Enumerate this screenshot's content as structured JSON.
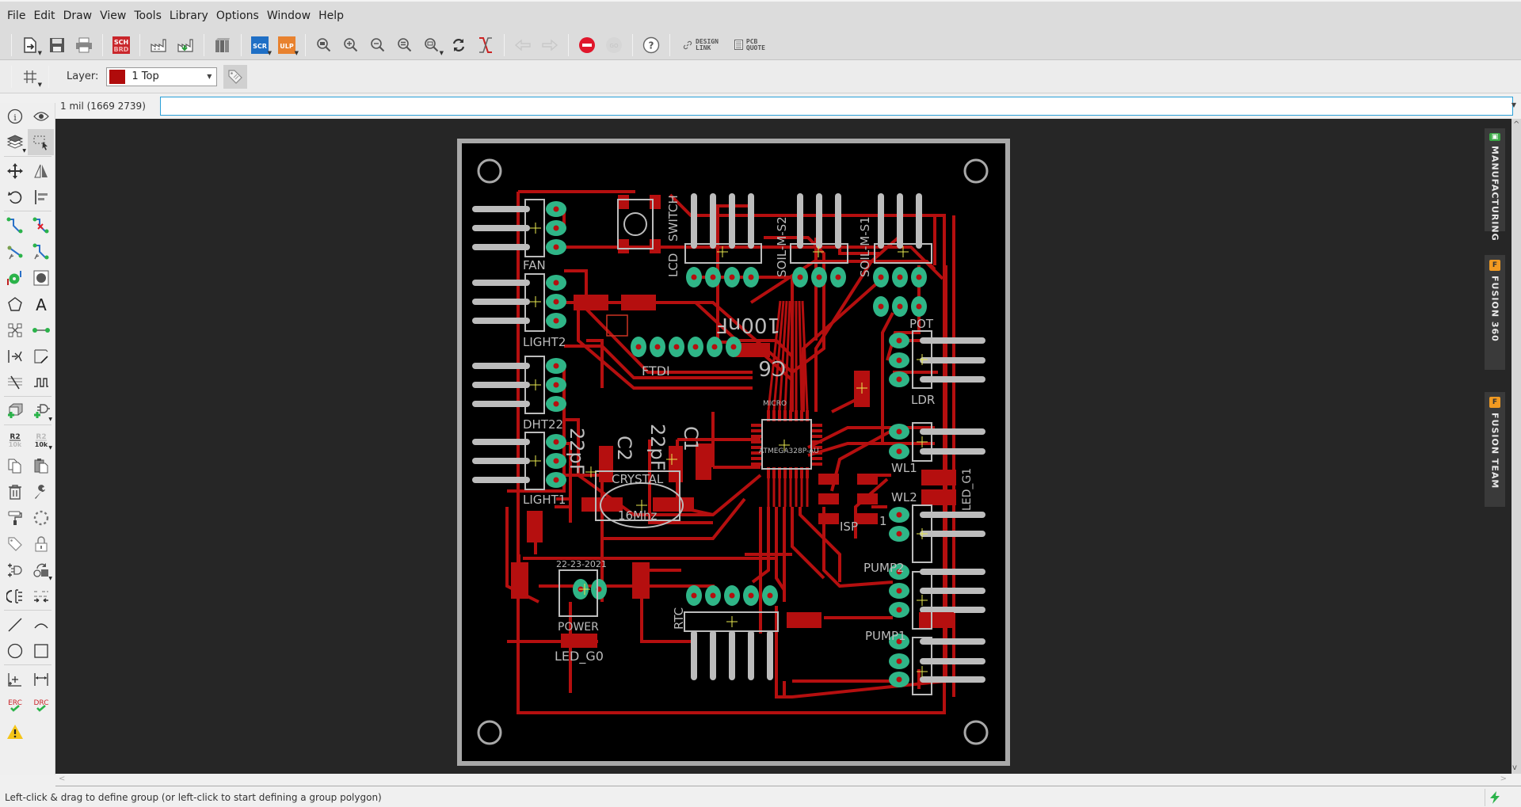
{
  "menubar": {
    "items": [
      "File",
      "Edit",
      "Draw",
      "View",
      "Tools",
      "Library",
      "Options",
      "Window",
      "Help"
    ]
  },
  "toolbar": {
    "buttons": [
      {
        "name": "open",
        "icon": "open-file-icon"
      },
      {
        "name": "save",
        "icon": "save-icon"
      },
      {
        "name": "print",
        "icon": "print-icon"
      },
      {
        "name": "sch-brd-switch",
        "icon": "sch-brd-icon",
        "label_top": "SCH",
        "label_bottom": "BRD"
      },
      {
        "name": "cam-processor",
        "icon": "factory-icon"
      },
      {
        "name": "manufacturing-export",
        "icon": "factory-download-icon"
      },
      {
        "name": "library",
        "icon": "books-icon"
      },
      {
        "name": "script",
        "icon": "scr-icon",
        "label": "SCR"
      },
      {
        "name": "ulp",
        "icon": "ulp-icon",
        "label": "ULP"
      },
      {
        "name": "zoom-fit",
        "icon": "zoom-fit-icon"
      },
      {
        "name": "zoom-in",
        "icon": "zoom-in-icon"
      },
      {
        "name": "zoom-out",
        "icon": "zoom-out-icon"
      },
      {
        "name": "zoom-redraw",
        "icon": "zoom-equal-icon"
      },
      {
        "name": "zoom-select",
        "icon": "zoom-select-icon"
      },
      {
        "name": "refresh",
        "icon": "refresh-icon"
      },
      {
        "name": "ratsnest",
        "icon": "ratsnest-icon"
      },
      {
        "name": "undo",
        "icon": "undo-icon",
        "disabled": true
      },
      {
        "name": "redo",
        "icon": "redo-icon",
        "disabled": true
      },
      {
        "name": "stop",
        "icon": "stop-icon"
      },
      {
        "name": "go",
        "icon": "go-icon",
        "disabled": true
      },
      {
        "name": "help",
        "icon": "help-icon"
      }
    ],
    "design_link": {
      "line1": "DESIGN",
      "line2": "LINK"
    },
    "pcb_quote": {
      "line1": "PCB",
      "line2": "QUOTE"
    }
  },
  "layerbar": {
    "label": "Layer:",
    "selected_layer": "1 Top",
    "layer_color": "#b00b0b"
  },
  "command": {
    "coordinate": "1 mil (1669 2739)",
    "value": "",
    "placeholder": ""
  },
  "lefttools": {
    "items": [
      "info",
      "show",
      "layers",
      "group-select",
      "move",
      "mirror",
      "rotate",
      "align",
      "route",
      "ripup",
      "fanout",
      "autoroute",
      "via",
      "hole",
      "polygon",
      "text",
      "split",
      "wire-connect",
      "miter",
      "slice",
      "meander",
      "meander-wave",
      "add-part",
      "add-component",
      "name",
      "value",
      "copy",
      "paste",
      "delete",
      "change",
      "smash-paint",
      "group-lasso",
      "attribute",
      "lock",
      "replace",
      "rotate-part",
      "swap-gate",
      "optimize",
      "line",
      "arc",
      "circle",
      "rectangle",
      "mark",
      "dimension",
      "erc",
      "drc",
      "warnings"
    ],
    "labels": {
      "name_top": "R2",
      "name_bottom": "10k",
      "erc": "ERC",
      "drc": "DRC"
    }
  },
  "side_panels": [
    {
      "label": "MANUFACTURING",
      "icon": "chip-icon",
      "color": "#3aa845"
    },
    {
      "label": "FUSION 360",
      "icon": "fusion-icon",
      "color": "#f29a21"
    },
    {
      "label": "FUSION TEAM",
      "icon": "fusion-icon",
      "color": "#f29a21"
    }
  ],
  "board": {
    "component_labels": {
      "fan": "FAN",
      "light2": "LIGHT2",
      "dht22": "DHT22",
      "light1": "LIGHT1",
      "lcd": "LCD",
      "switch": "SWITCH",
      "soil_s2": "SOIL-M-S2",
      "soil_s1": "SOIL-M-S1",
      "pot": "POT",
      "ldr": "LDR",
      "ftdi": "FTDI",
      "cap_100nf": "100nF",
      "c6": "C6",
      "micro": "MICRO",
      "mcu": "ATMEGA328P-AU",
      "cap_22pf_1": "22pF",
      "cap_22pf_2": "22pF",
      "c2": "C2",
      "c1": "C1",
      "crystal": "CRYSTAL",
      "crystal_val": "16Mhz",
      "wl1": "WL1",
      "wl2": "WL2",
      "led_g1": "LED_G1",
      "isp": "ISP",
      "isp_pin": "1",
      "pump2": "PUMP2",
      "pump1": "PUMP1",
      "date": "22-23-2021",
      "power": "POWER",
      "led_g0": "LED_G0",
      "rtc": "RTC"
    },
    "colors": {
      "board_bg": "#000000",
      "outline": "#a8a8a8",
      "trace": "#b50f0f",
      "pad": "#2fb587",
      "silk": "#bcbcbc",
      "origin": "#e8e850"
    }
  },
  "status": {
    "message": "Left-click & drag to define group (or left-click to start defining a group polygon)"
  }
}
